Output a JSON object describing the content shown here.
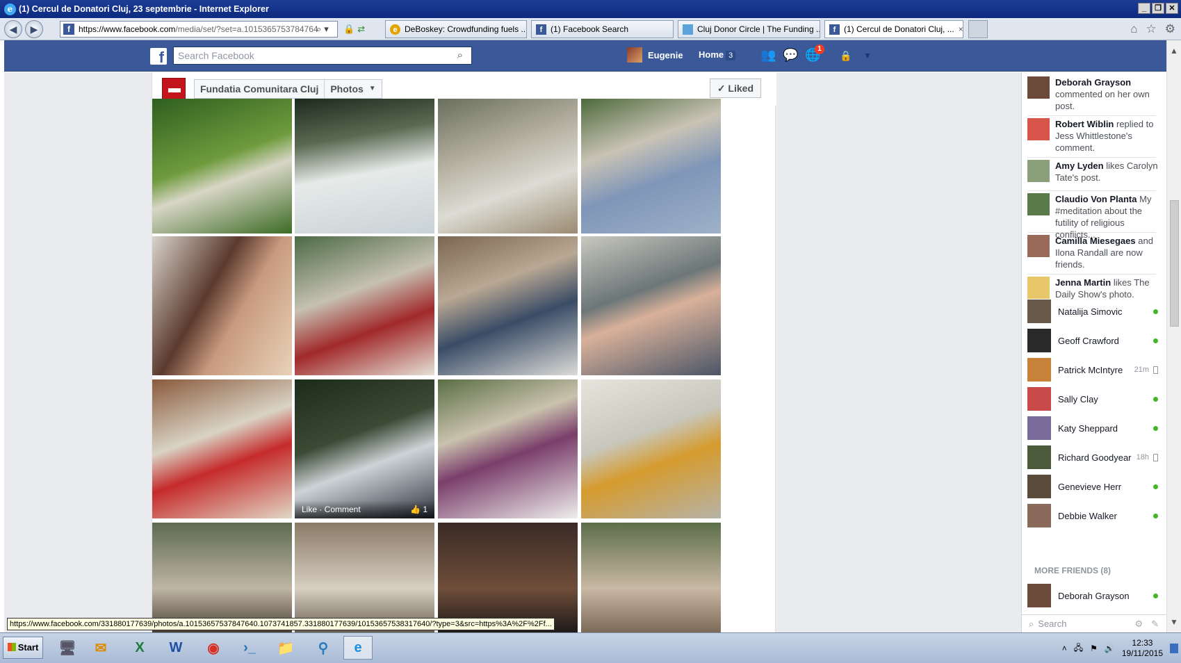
{
  "window": {
    "title": "(1) Cercul de Donatori Cluj, 23 septembrie - Internet Explorer"
  },
  "browser": {
    "url_host": "https://www.facebook.com",
    "url_rest": "/media/set/?set=a.1015365753784764",
    "tabs": [
      {
        "label": "DeBoskey: Crowdfunding fuels ...",
        "icon": "ie-page-icon",
        "active": false
      },
      {
        "label": "(1) Facebook Search",
        "icon": "facebook-icon",
        "active": false
      },
      {
        "label": "Cluj Donor Circle | The Funding ...",
        "icon": "page-icon",
        "active": false
      },
      {
        "label": "(1) Cercul de Donatori Cluj, ...",
        "icon": "facebook-icon",
        "active": true,
        "close": "×"
      }
    ]
  },
  "facebook": {
    "search_placeholder": "Search Facebook",
    "user_name": "Eugenie",
    "home_label": "Home",
    "home_count": "3",
    "notification_count": "1"
  },
  "album": {
    "page_name": "Fundatia Comunitara Cluj",
    "section": "Photos",
    "liked_label": "✓ Liked"
  },
  "photos": [
    {
      "bg": "linear-gradient(160deg,#2e5f1f,#6f9b3d 45%,#d8d6c6 60%,#3c6b24)"
    },
    {
      "bg": "linear-gradient(170deg,#1c2a1d,#5a6a52 30%,#e6ebe9 55%,#c9d2d6)"
    },
    {
      "bg": "linear-gradient(160deg,#6a6f5d,#b8b3a4 40%,#dcdcd4 65%,#9a8a72)"
    },
    {
      "bg": "linear-gradient(160deg,#4d6a3c,#c9c3b5 35%,#7f96b8 60%,#9fb1c9)"
    },
    {
      "bg": "linear-gradient(120deg,#d8d3cb,#5b3a2e 40%,#c89a7e 60%,#e8d2b8)"
    },
    {
      "bg": "linear-gradient(160deg,#4c6a45,#c6c1b2 40%,#a1292a 65%,#e5e1d6)"
    },
    {
      "bg": "linear-gradient(160deg,#7b6652,#b9a893 35%,#3a4c66 60%,#dcdcd8)"
    },
    {
      "bg": "linear-gradient(160deg,#c8c8bf,#6c7678 40%,#d9b19a 55%,#4a5566)"
    },
    {
      "bg": "linear-gradient(160deg,#8a5a3c,#d9d3c4 40%,#c52b2b 60%,#e1d7c5)"
    },
    {
      "bg": "linear-gradient(160deg,#1d2b1a,#3b4a35 40%,#cdd3d6 60%,#2f3540)",
      "like_label": "Like · Comment",
      "likes": "1"
    },
    {
      "bg": "linear-gradient(160deg,#5a6e45,#c9c2ad 35%,#7a3e6b 55%,#eeeeec)"
    },
    {
      "bg": "linear-gradient(160deg,#e6e4dc,#c8c7bd 40%,#d59b2e 60%,#b6b3a8)"
    },
    {
      "bg": "linear-gradient(180deg,#5d6a52,#bfb5a4 60%,#4a3f36)"
    },
    {
      "bg": "linear-gradient(180deg,#8a7a68,#d8cfc2 60%,#6a5e52)"
    },
    {
      "bg": "linear-gradient(180deg,#3a2a26,#6f4e3a 60%,#1f1a18)"
    },
    {
      "bg": "linear-gradient(180deg,#5c6e4a,#c9b8a4 60%,#7c6a58)"
    }
  ],
  "ticker": [
    {
      "name": "Deborah Grayson",
      "text": "commented on her own post.",
      "av": "#6b4a3a"
    },
    {
      "name": "Robert Wiblin",
      "text": "replied to Jess Whittlestone's comment.",
      "av": "#d8554b"
    },
    {
      "name": "Amy Lyden",
      "text": "likes Carolyn Tate's post.",
      "av": "#8ba07a"
    },
    {
      "name": "Claudio Von Planta",
      "text": "My #meditation about the futility of religious conflicts...",
      "av": "#5a7a4a"
    },
    {
      "name": "Camilla Miesegaes",
      "text": "and Ilona Randall are now friends.",
      "av": "#9a6a5a"
    },
    {
      "name": "Jenna Martin",
      "text": "likes The Daily Show's photo.",
      "av": "#e8c76a"
    }
  ],
  "friends": [
    {
      "name": "Natalija Simovic",
      "status": "",
      "av": "#6a5a4a",
      "online": true
    },
    {
      "name": "Geoff Crawford",
      "status": "",
      "av": "#2a2a2a",
      "online": true
    },
    {
      "name": "Patrick McIntyre",
      "status": "21m",
      "av": "#c8823a",
      "online": false
    },
    {
      "name": "Sally Clay",
      "status": "",
      "av": "#c84a4a",
      "online": true
    },
    {
      "name": "Katy Sheppard",
      "status": "",
      "av": "#7a6a9a",
      "online": true
    },
    {
      "name": "Richard Goodyear",
      "status": "18h",
      "av": "#4a5a3a",
      "online": false
    },
    {
      "name": "Genevieve Herr",
      "status": "",
      "av": "#5a4a3a",
      "online": true
    },
    {
      "name": "Debbie Walker",
      "status": "",
      "av": "#8a6a5a",
      "online": true
    }
  ],
  "more_friends_label": "MORE FRIENDS (8)",
  "more_friends": [
    {
      "name": "Deborah Grayson",
      "status": "",
      "av": "#6b4a3a",
      "online": true
    }
  ],
  "chat_search_placeholder": "Search",
  "status_url": "https://www.facebook.com/331880177639/photos/a.10153657537847640.1073741857.331880177639/10153657538317640/?type=3&src=https%3A%2F%2Ff...",
  "taskbar": {
    "start_label": "Start",
    "time": "12:33",
    "date": "19/11/2015"
  }
}
